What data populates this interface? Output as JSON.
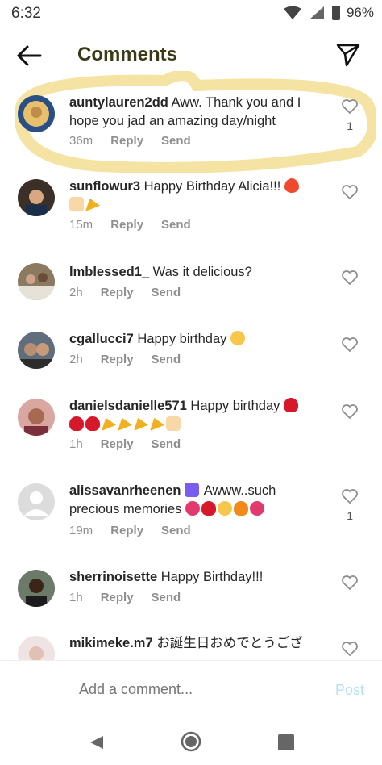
{
  "status_bar": {
    "time": "6:32",
    "battery": "96%"
  },
  "header": {
    "title": "Comments"
  },
  "comments": [
    {
      "username": "auntylauren2dd",
      "text": "Aww.  Thank you and I hope you jad an amazing day/night",
      "age": "36m",
      "reply": "Reply",
      "send": "Send",
      "likes": "1"
    },
    {
      "username": "sunflowur3",
      "text": "Happy Birthday Alicia!!!",
      "age": "15m",
      "reply": "Reply",
      "send": "Send",
      "likes": ""
    },
    {
      "username": "lmblessed1_",
      "text": "Was it delicious?",
      "age": "2h",
      "reply": "Reply",
      "send": "Send",
      "likes": ""
    },
    {
      "username": "cgallucci7",
      "text": "Happy birthday",
      "age": "2h",
      "reply": "Reply",
      "send": "Send",
      "likes": ""
    },
    {
      "username": "danielsdanielle571",
      "text": "Happy birthday",
      "age": "1h",
      "reply": "Reply",
      "send": "Send",
      "likes": ""
    },
    {
      "username": "alissavanrheenen",
      "text": "Awww..such precious memories",
      "age": "19m",
      "reply": "Reply",
      "send": "Send",
      "likes": "1"
    },
    {
      "username": "sherrinoisette",
      "text": "Happy Birthday!!!",
      "age": "1h",
      "reply": "Reply",
      "send": "Send",
      "likes": ""
    },
    {
      "username": "mikimeke.m7",
      "text": "お誕生日おめでとうござ",
      "age": "",
      "reply": "",
      "send": "",
      "likes": ""
    }
  ],
  "composer": {
    "placeholder": "Add a comment...",
    "post_label": "Post"
  },
  "colors": {
    "highlight": "#f5e3a3",
    "post": "#b2dffc"
  }
}
